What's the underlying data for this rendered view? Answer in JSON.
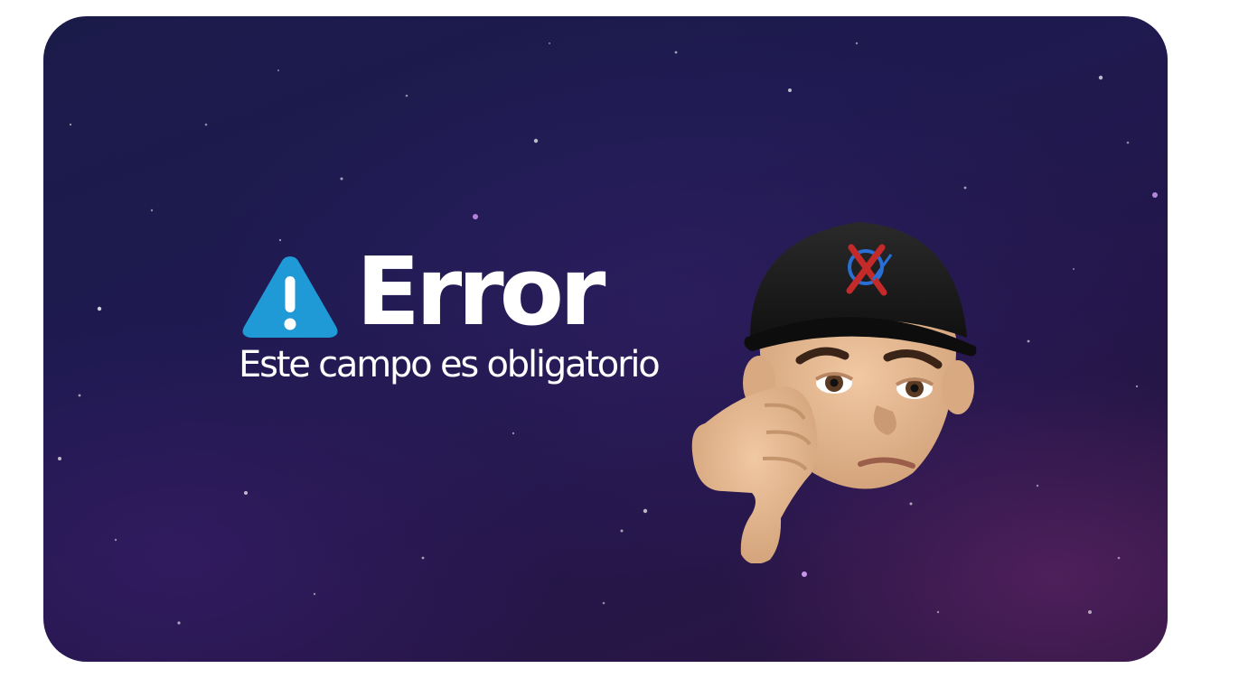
{
  "dialog": {
    "title": "Error",
    "message": "Este campo es obligatorio"
  },
  "icons": {
    "warning": "warning-triangle-icon",
    "avatar": "thumbs-down-avatar"
  },
  "colors": {
    "background": "#1e1a50",
    "warning_icon": "#1f9ad6",
    "text": "#ffffff",
    "cap": "#1a1a1a",
    "skin": "#e0b48e"
  }
}
